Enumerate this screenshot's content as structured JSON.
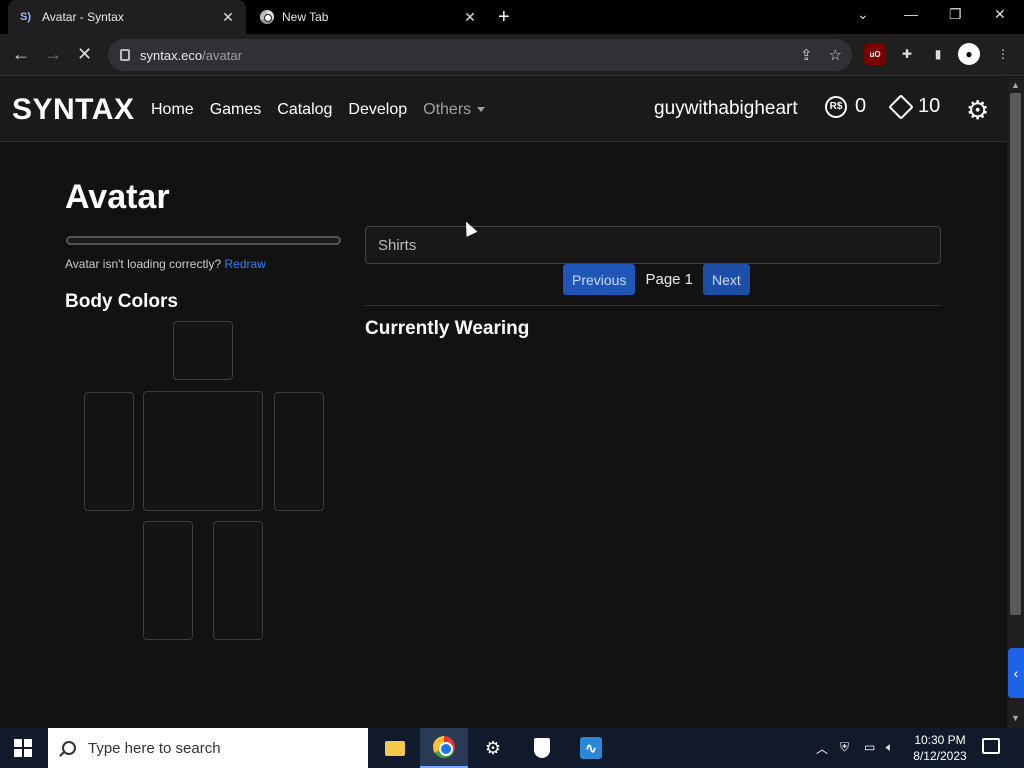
{
  "browser": {
    "tabs": [
      {
        "title": "Avatar - Syntax",
        "favicon": "S)",
        "active": true
      },
      {
        "title": "New Tab",
        "active": false
      }
    ],
    "new_tab_glyph": "+",
    "close_glyph": "✕",
    "address": {
      "host": "syntax.eco",
      "path": "/avatar"
    }
  },
  "site": {
    "logo": "SYNTAX",
    "nav": [
      "Home",
      "Games",
      "Catalog",
      "Develop"
    ],
    "others_label": "Others",
    "username": "guywithabigheart",
    "robux_symbol": "R$",
    "robux": "0",
    "tix": "10"
  },
  "page": {
    "title": "Avatar",
    "progress": 0.0,
    "loading_msg": "Avatar isn't loading correctly?",
    "redraw_link": "Redraw",
    "body_colors_title": "Body Colors",
    "category_value": "Shirts",
    "prev_label": "Previous",
    "page_label": "Page 1",
    "next_label": "Next",
    "currently_wearing": "Currently Wearing"
  },
  "taskbar": {
    "search_placeholder": "Type here to search",
    "time": "10:30 PM",
    "date": "8/12/2023"
  },
  "colors": {
    "accent": "#0d6efd",
    "background": "#121212"
  }
}
